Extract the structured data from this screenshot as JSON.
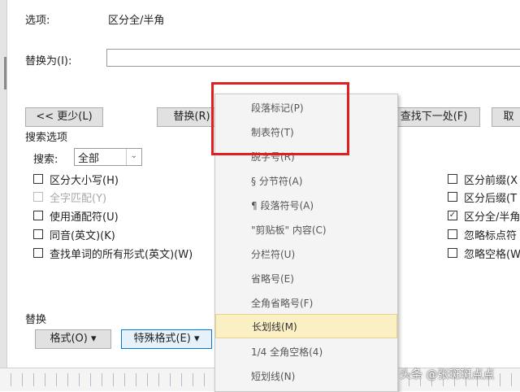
{
  "top": {
    "options_label": "选项:",
    "options_value": "区分全/半角"
  },
  "replace_with_label": "替换为(I):",
  "buttons": {
    "less": "<< 更少(L)",
    "replace": "替换(R)",
    "find_next": "查找下一处(F)",
    "cancel": "取"
  },
  "search_options": {
    "title": "搜索选项",
    "search_label": "搜索:",
    "search_value": "全部",
    "left_checks": [
      {
        "label": "区分大小写(H)",
        "checked": false,
        "disabled": false
      },
      {
        "label": "全字匹配(Y)",
        "checked": false,
        "disabled": true
      },
      {
        "label": "使用通配符(U)",
        "checked": false,
        "disabled": false
      },
      {
        "label": "同音(英文)(K)",
        "checked": false,
        "disabled": false
      },
      {
        "label": "查找单词的所有形式(英文)(W)",
        "checked": false,
        "disabled": false
      }
    ],
    "right_checks": [
      {
        "label": "区分前缀(X",
        "checked": false
      },
      {
        "label": "区分后缀(T",
        "checked": false
      },
      {
        "label": "区分全/半角",
        "checked": true
      },
      {
        "label": "忽略标点符",
        "checked": false
      },
      {
        "label": "忽略空格(W",
        "checked": false
      }
    ]
  },
  "replace_section": {
    "title": "替换",
    "format_button": "格式(O) ▾",
    "special_button": "特殊格式(E) ▾"
  },
  "special_menu": {
    "items": [
      "段落标记(P)",
      "制表符(T)",
      "脱字号(R)",
      "§ 分节符(A)",
      "¶ 段落符号(A)",
      "\"剪贴板\" 内容(C)",
      "分栏符(U)",
      "省略号(E)",
      "全角省略号(F)",
      "长划线(M)",
      "1/4 全角空格(4)",
      "短划线(N)"
    ],
    "highlighted_index": 9
  },
  "watermark": "头条 @张斑斑点点",
  "colors": {
    "highlight_bg": "#fbefc4",
    "annotation_red": "#e02020"
  }
}
